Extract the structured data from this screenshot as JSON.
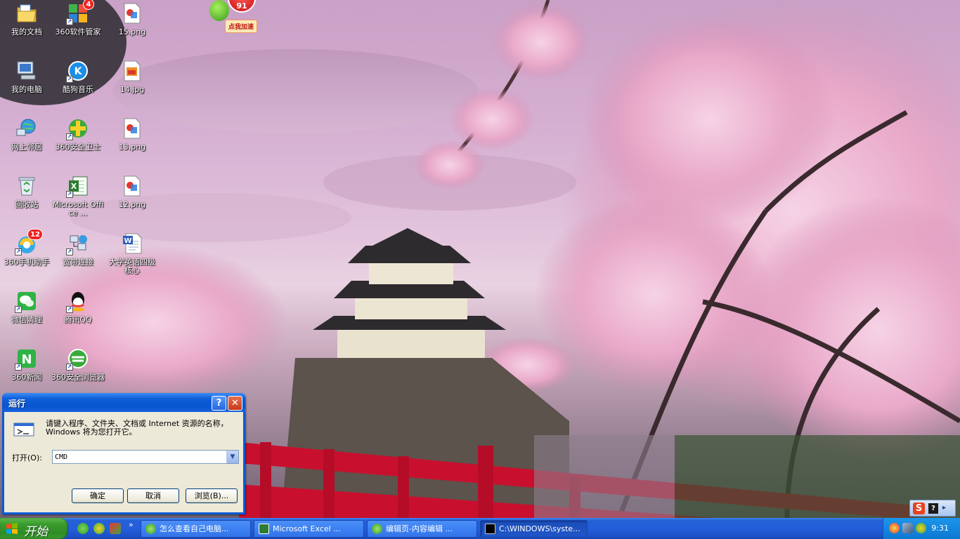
{
  "desktop": {
    "icons": [
      {
        "label": "我的文档",
        "icon": "folder-documents-icon"
      },
      {
        "label": "360软件管家",
        "icon": "software-manager-icon",
        "badge": "4"
      },
      {
        "label": "15.png",
        "icon": "image-file-icon"
      },
      {
        "label": "我的电脑",
        "icon": "computer-icon"
      },
      {
        "label": "酷狗音乐",
        "icon": "kugou-music-icon"
      },
      {
        "label": "14.jpg",
        "icon": "jpg-file-icon"
      },
      {
        "label": "网上邻居",
        "icon": "network-icon"
      },
      {
        "label": "360安全卫士",
        "icon": "360-guard-icon"
      },
      {
        "label": "13.png",
        "icon": "image-file-icon"
      },
      {
        "label": "回收站",
        "icon": "recycle-bin-icon"
      },
      {
        "label": "Microsoft Office ...",
        "icon": "excel-icon"
      },
      {
        "label": "12.png",
        "icon": "image-file-icon"
      },
      {
        "label": "360手机助手",
        "icon": "360-mobile-icon",
        "badge": "12"
      },
      {
        "label": "宽带连接",
        "icon": "broadband-icon"
      },
      {
        "label": "大学英语四级核心",
        "icon": "word-doc-icon"
      },
      {
        "label": "微信清理",
        "icon": "wechat-cleaner-icon"
      },
      {
        "label": "腾讯QQ",
        "icon": "qq-icon"
      },
      {
        "label": "360新闻",
        "icon": "360-news-icon"
      },
      {
        "label": "360安全浏览器",
        "icon": "360-browser-icon"
      }
    ],
    "speed_widget": {
      "value": "91",
      "label": "点我加速"
    }
  },
  "run_dialog": {
    "title": "运行",
    "help_label": "?",
    "close_label": "✕",
    "description": "请键入程序、文件夹、文档或 Internet 资源的名称，Windows 将为您打开它。",
    "open_label": "打开(O):",
    "open_value": "CMD",
    "ok_label": "确定",
    "cancel_label": "取消",
    "browse_label": "浏览(B)..."
  },
  "taskbar": {
    "start_label": "开始",
    "more_label": "»",
    "tasks": [
      {
        "label": "怎么查看自己电脑...",
        "icon": "ie-browser-icon"
      },
      {
        "label": "Microsoft Excel ...",
        "icon": "excel-icon"
      },
      {
        "label": "编辑页-内容编辑 ...",
        "icon": "ie-browser-icon"
      },
      {
        "label": "C:\\WINDOWS\\syste...",
        "icon": "cmd-icon"
      }
    ],
    "clock": "9:31"
  },
  "ime_bar": {
    "s_label": "S",
    "help_label": "?",
    "menu_label": "▸"
  }
}
